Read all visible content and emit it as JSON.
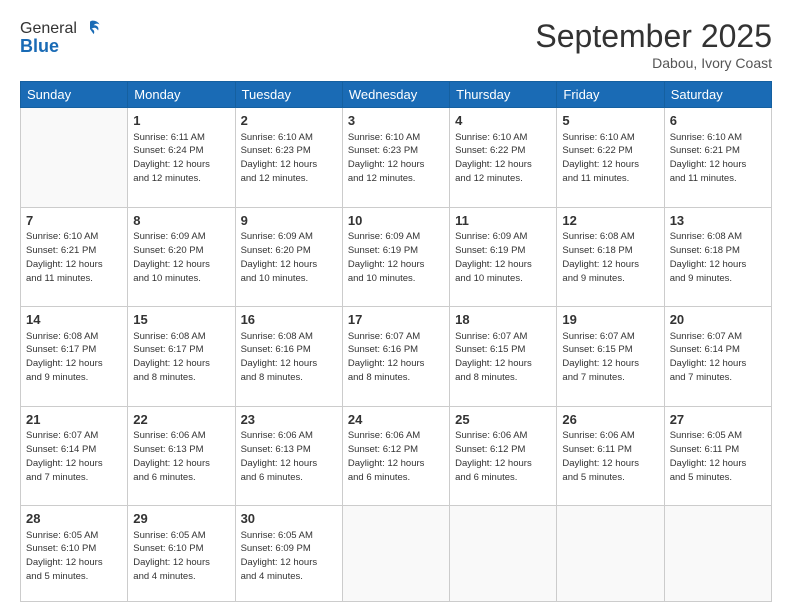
{
  "logo": {
    "general": "General",
    "blue": "Blue"
  },
  "header": {
    "month_year": "September 2025",
    "location": "Dabou, Ivory Coast"
  },
  "days_of_week": [
    "Sunday",
    "Monday",
    "Tuesday",
    "Wednesday",
    "Thursday",
    "Friday",
    "Saturday"
  ],
  "weeks": [
    [
      {
        "day": "",
        "info": ""
      },
      {
        "day": "1",
        "info": "Sunrise: 6:11 AM\nSunset: 6:24 PM\nDaylight: 12 hours\nand 12 minutes."
      },
      {
        "day": "2",
        "info": "Sunrise: 6:10 AM\nSunset: 6:23 PM\nDaylight: 12 hours\nand 12 minutes."
      },
      {
        "day": "3",
        "info": "Sunrise: 6:10 AM\nSunset: 6:23 PM\nDaylight: 12 hours\nand 12 minutes."
      },
      {
        "day": "4",
        "info": "Sunrise: 6:10 AM\nSunset: 6:22 PM\nDaylight: 12 hours\nand 12 minutes."
      },
      {
        "day": "5",
        "info": "Sunrise: 6:10 AM\nSunset: 6:22 PM\nDaylight: 12 hours\nand 11 minutes."
      },
      {
        "day": "6",
        "info": "Sunrise: 6:10 AM\nSunset: 6:21 PM\nDaylight: 12 hours\nand 11 minutes."
      }
    ],
    [
      {
        "day": "7",
        "info": "Sunrise: 6:10 AM\nSunset: 6:21 PM\nDaylight: 12 hours\nand 11 minutes."
      },
      {
        "day": "8",
        "info": "Sunrise: 6:09 AM\nSunset: 6:20 PM\nDaylight: 12 hours\nand 10 minutes."
      },
      {
        "day": "9",
        "info": "Sunrise: 6:09 AM\nSunset: 6:20 PM\nDaylight: 12 hours\nand 10 minutes."
      },
      {
        "day": "10",
        "info": "Sunrise: 6:09 AM\nSunset: 6:19 PM\nDaylight: 12 hours\nand 10 minutes."
      },
      {
        "day": "11",
        "info": "Sunrise: 6:09 AM\nSunset: 6:19 PM\nDaylight: 12 hours\nand 10 minutes."
      },
      {
        "day": "12",
        "info": "Sunrise: 6:08 AM\nSunset: 6:18 PM\nDaylight: 12 hours\nand 9 minutes."
      },
      {
        "day": "13",
        "info": "Sunrise: 6:08 AM\nSunset: 6:18 PM\nDaylight: 12 hours\nand 9 minutes."
      }
    ],
    [
      {
        "day": "14",
        "info": "Sunrise: 6:08 AM\nSunset: 6:17 PM\nDaylight: 12 hours\nand 9 minutes."
      },
      {
        "day": "15",
        "info": "Sunrise: 6:08 AM\nSunset: 6:17 PM\nDaylight: 12 hours\nand 8 minutes."
      },
      {
        "day": "16",
        "info": "Sunrise: 6:08 AM\nSunset: 6:16 PM\nDaylight: 12 hours\nand 8 minutes."
      },
      {
        "day": "17",
        "info": "Sunrise: 6:07 AM\nSunset: 6:16 PM\nDaylight: 12 hours\nand 8 minutes."
      },
      {
        "day": "18",
        "info": "Sunrise: 6:07 AM\nSunset: 6:15 PM\nDaylight: 12 hours\nand 8 minutes."
      },
      {
        "day": "19",
        "info": "Sunrise: 6:07 AM\nSunset: 6:15 PM\nDaylight: 12 hours\nand 7 minutes."
      },
      {
        "day": "20",
        "info": "Sunrise: 6:07 AM\nSunset: 6:14 PM\nDaylight: 12 hours\nand 7 minutes."
      }
    ],
    [
      {
        "day": "21",
        "info": "Sunrise: 6:07 AM\nSunset: 6:14 PM\nDaylight: 12 hours\nand 7 minutes."
      },
      {
        "day": "22",
        "info": "Sunrise: 6:06 AM\nSunset: 6:13 PM\nDaylight: 12 hours\nand 6 minutes."
      },
      {
        "day": "23",
        "info": "Sunrise: 6:06 AM\nSunset: 6:13 PM\nDaylight: 12 hours\nand 6 minutes."
      },
      {
        "day": "24",
        "info": "Sunrise: 6:06 AM\nSunset: 6:12 PM\nDaylight: 12 hours\nand 6 minutes."
      },
      {
        "day": "25",
        "info": "Sunrise: 6:06 AM\nSunset: 6:12 PM\nDaylight: 12 hours\nand 6 minutes."
      },
      {
        "day": "26",
        "info": "Sunrise: 6:06 AM\nSunset: 6:11 PM\nDaylight: 12 hours\nand 5 minutes."
      },
      {
        "day": "27",
        "info": "Sunrise: 6:05 AM\nSunset: 6:11 PM\nDaylight: 12 hours\nand 5 minutes."
      }
    ],
    [
      {
        "day": "28",
        "info": "Sunrise: 6:05 AM\nSunset: 6:10 PM\nDaylight: 12 hours\nand 5 minutes."
      },
      {
        "day": "29",
        "info": "Sunrise: 6:05 AM\nSunset: 6:10 PM\nDaylight: 12 hours\nand 4 minutes."
      },
      {
        "day": "30",
        "info": "Sunrise: 6:05 AM\nSunset: 6:09 PM\nDaylight: 12 hours\nand 4 minutes."
      },
      {
        "day": "",
        "info": ""
      },
      {
        "day": "",
        "info": ""
      },
      {
        "day": "",
        "info": ""
      },
      {
        "day": "",
        "info": ""
      }
    ]
  ]
}
